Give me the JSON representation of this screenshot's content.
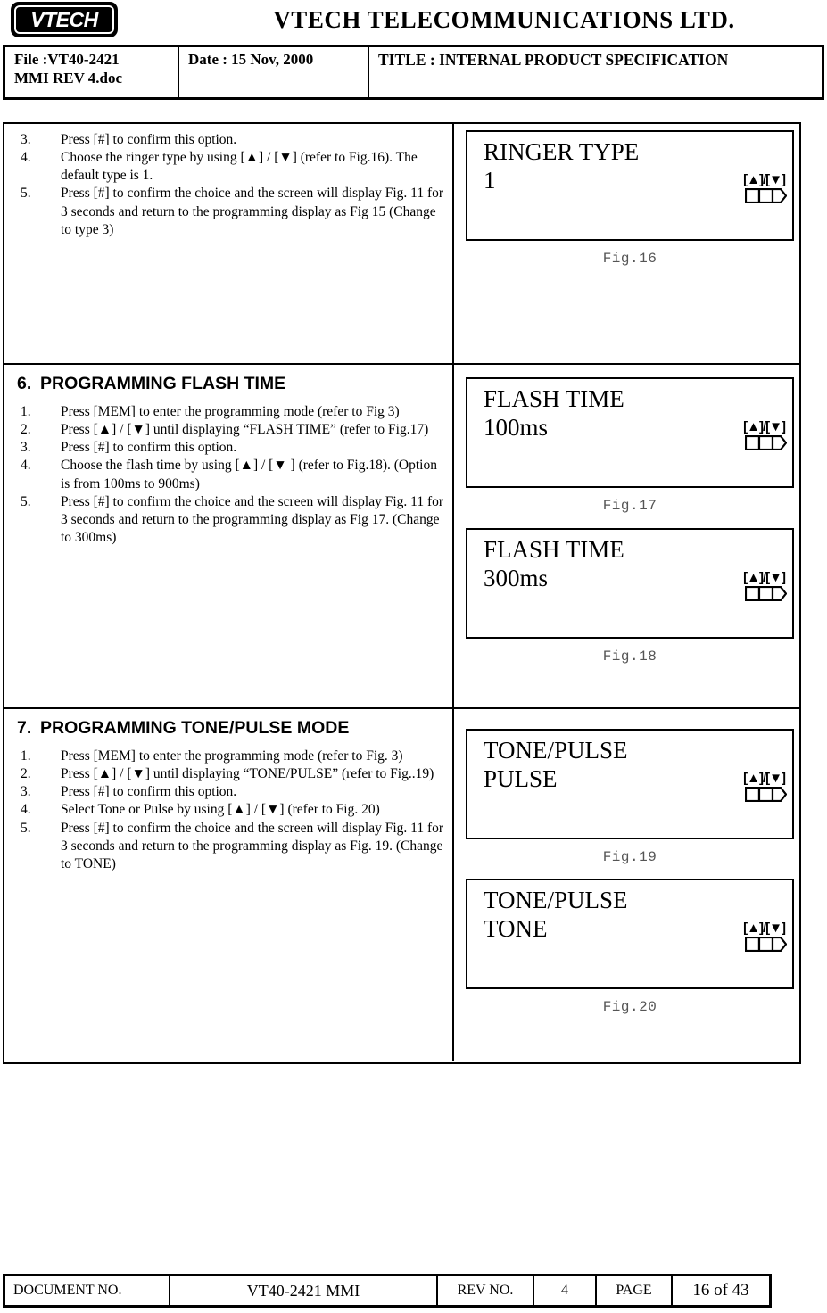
{
  "header": {
    "logo_text": "VTECH",
    "logo_icon": "vtech-logo",
    "company_title": "VTECH  TELECOMMUNICATIONS  LTD.",
    "file_label": "File :VT40-2421",
    "file_label_line2": "MMI REV 4.doc",
    "date_label": "Date :  15 Nov, 2000",
    "title_label": "TITLE : INTERNAL PRODUCT SPECIFICATION"
  },
  "sections": [
    {
      "heading": "",
      "heading_number": "",
      "steps": [
        {
          "num": "3.",
          "text": "Press [#] to confirm this option."
        },
        {
          "num": "4.",
          "text": "Choose the ringer type by using [▲] / [▼] (refer to Fig.16).  The default type is 1."
        },
        {
          "num": "5.",
          "text": "Press [#] to confirm the choice and the screen will display Fig. 11 for 3 seconds and return to the programming display as Fig 15 (Change to type 3)"
        }
      ],
      "figures": [
        {
          "line1": "RINGER TYPE",
          "line2": "1",
          "keys": "[▲]/[▼]",
          "caption": "Fig.16"
        }
      ]
    },
    {
      "heading": "PROGRAMMING FLASH TIME",
      "heading_number": "6.",
      "steps": [
        {
          "num": "1.",
          "text": "Press [MEM] to enter the programming mode (refer to Fig 3)"
        },
        {
          "num": "2.",
          "text": "Press  [▲] / [▼] until displaying “FLASH TIME” (refer to Fig.17)"
        },
        {
          "num": "3.",
          "text": "Press [#] to confirm this option."
        },
        {
          "num": "4.",
          "text": "Choose the flash time by using [▲] / [▼ ] (refer to Fig.18).  (Option is from 100ms to 900ms)"
        },
        {
          "num": "5.",
          "text": "Press [#] to confirm the choice and the screen will display Fig. 11 for 3 seconds and return to the programming display as Fig 17. (Change to 300ms)"
        }
      ],
      "figures": [
        {
          "line1": "FLASH TIME",
          "line2": "100ms",
          "keys": "[▲]/[▼]",
          "caption": "Fig.17"
        },
        {
          "line1": "FLASH TIME",
          "line2": "300ms",
          "keys": "[▲]/[▼]",
          "caption": "Fig.18"
        }
      ]
    },
    {
      "heading": "PROGRAMMING TONE/PULSE MODE",
      "heading_number": "7.",
      "steps": [
        {
          "num": "1.",
          "text": "Press [MEM] to enter the programming mode (refer to Fig. 3)"
        },
        {
          "num": "2.",
          "text": "Press  [▲] / [▼] until displaying “TONE/PULSE” (refer to Fig..19)"
        },
        {
          "num": "3.",
          "text": "Press [#] to confirm this option."
        },
        {
          "num": "4.",
          "text": "Select Tone or Pulse by using [▲] / [▼] (refer to Fig. 20)"
        },
        {
          "num": "5.",
          "text": "Press [#] to confirm the choice and the screen will display Fig. 11 for 3 seconds and return to the programming display as Fig. 19. (Change to TONE)"
        }
      ],
      "figures": [
        {
          "line1": "TONE/PULSE",
          "line2": "PULSE",
          "keys": "[▲]/[▼]",
          "caption": "Fig.19"
        },
        {
          "line1": "TONE/PULSE",
          "line2": "TONE",
          "keys": "[▲]/[▼]",
          "caption": "Fig.20"
        }
      ]
    }
  ],
  "footer": {
    "document_no_label": "DOCUMENT NO.",
    "document_no_value": "VT40-2421  MMI",
    "rev_no_label": "REV NO.",
    "rev_no_value": "4",
    "page_label": "PAGE",
    "page_value": "16 of 43"
  },
  "colors": {
    "ink": "#000000",
    "paper": "#ffffff",
    "caption_gray": "#555555"
  }
}
